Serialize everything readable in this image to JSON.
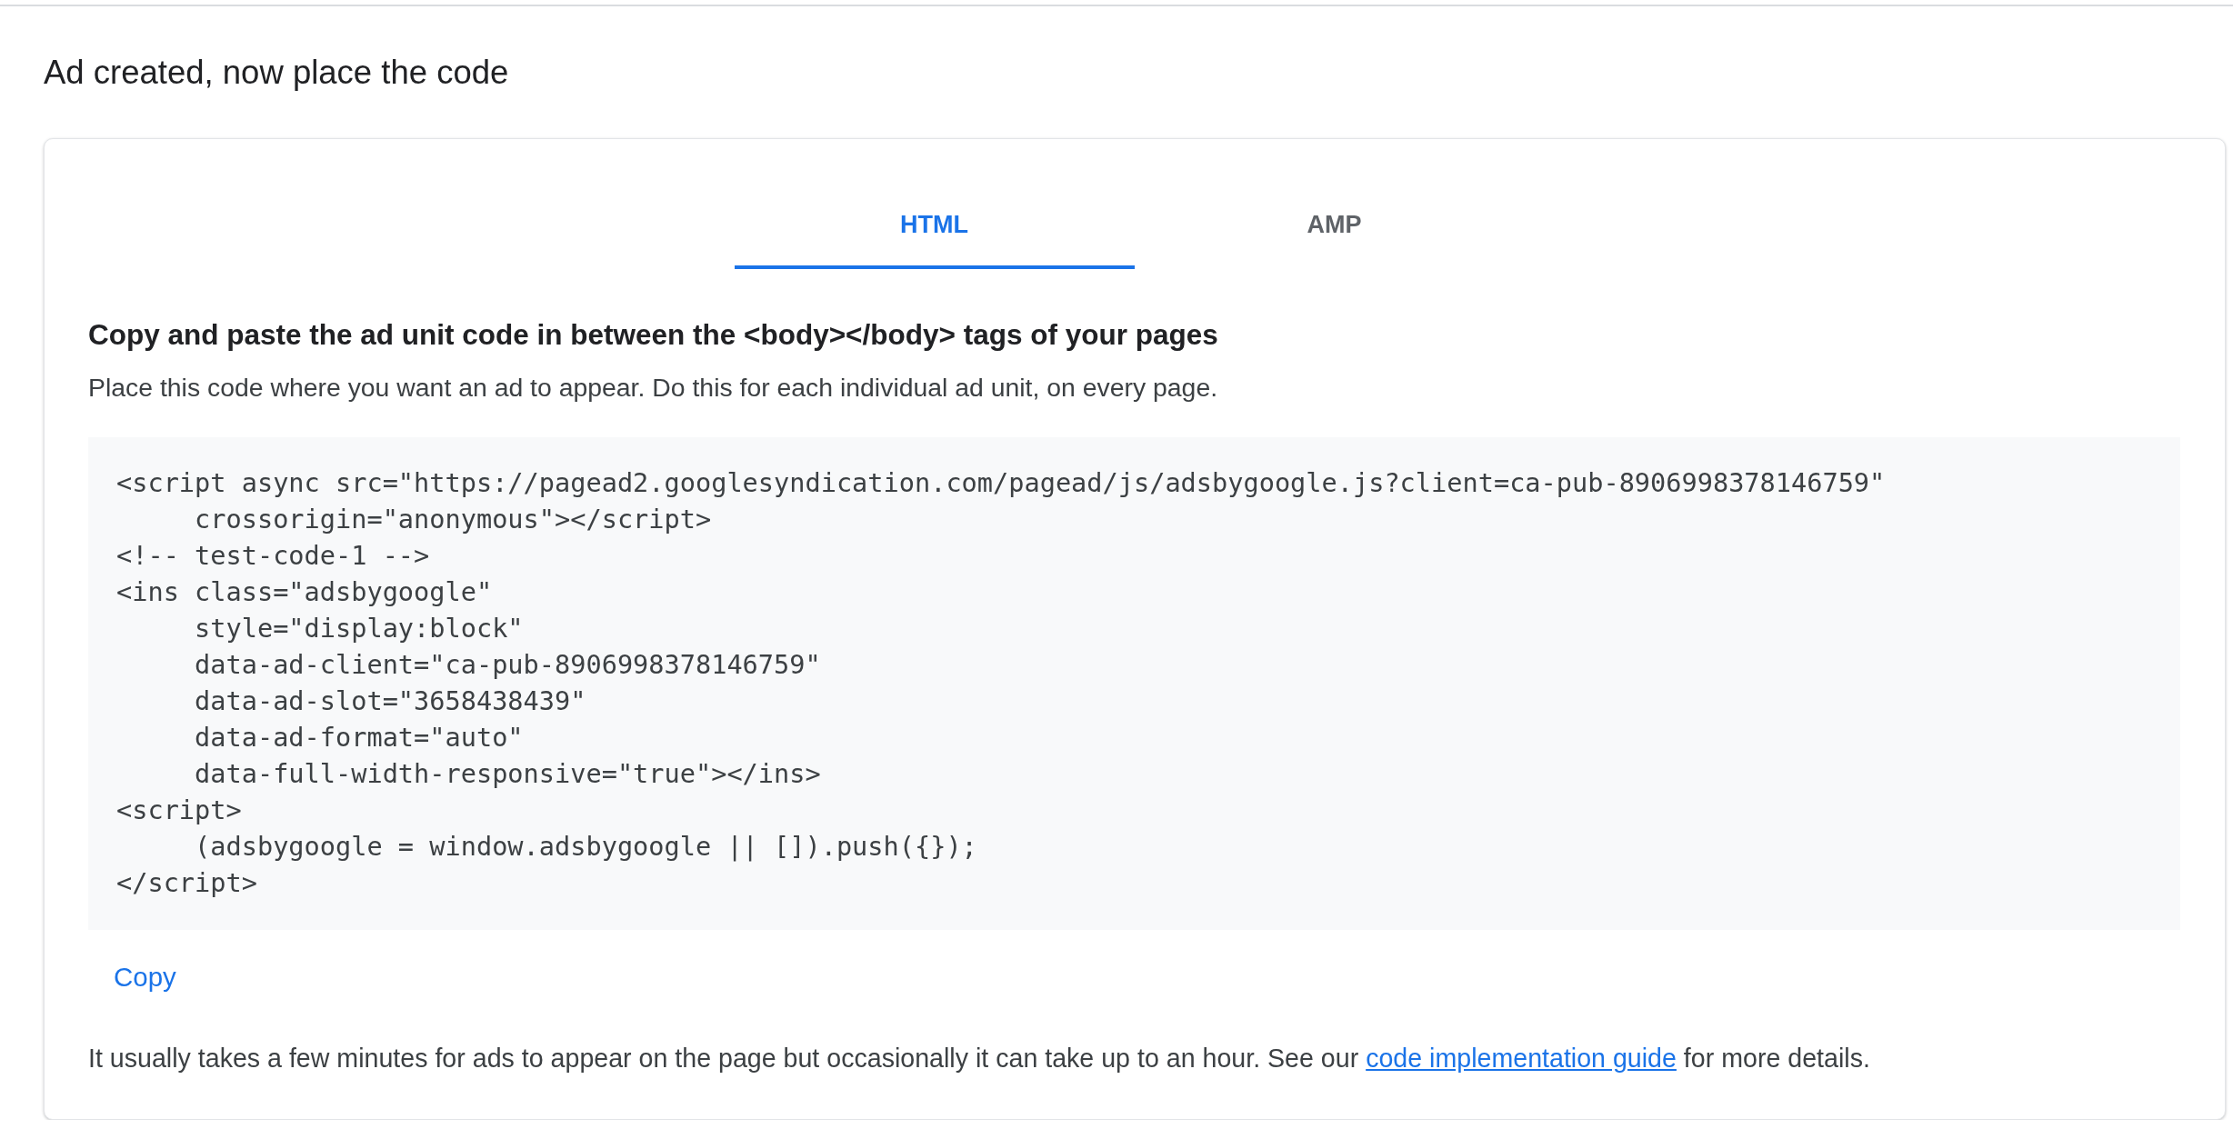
{
  "page_title": "Ad created, now place the code",
  "tabs": [
    {
      "label": "HTML",
      "selected": true
    },
    {
      "label": "AMP",
      "selected": false
    }
  ],
  "heading": "Copy and paste the ad unit code in between the <body></body> tags of your pages",
  "instructions": "Place this code where you want an ad to appear. Do this for each individual ad unit, on every page.",
  "code_lines": [
    "<script async src=\"https://pagead2.googlesyndication.com/pagead/js/adsbygoogle.js?client=ca-pub-8906998378146759\"",
    "     crossorigin=\"anonymous\"></script>",
    "<!-- test-code-1 -->",
    "<ins class=\"adsbygoogle\"",
    "     style=\"display:block\"",
    "     data-ad-client=\"ca-pub-8906998378146759\"",
    "     data-ad-slot=\"3658438439\"",
    "     data-ad-format=\"auto\"",
    "     data-full-width-responsive=\"true\"></ins>",
    "<script>",
    "     (adsbygoogle = window.adsbygoogle || []).push({});",
    "</script>"
  ],
  "copy_button": "Copy",
  "note": {
    "text_before": "It usually takes a few minutes for ads to appear on the page but occasionally it can take up to an hour. See our ",
    "link": "code implementation guide",
    "text_after": " for more details."
  }
}
